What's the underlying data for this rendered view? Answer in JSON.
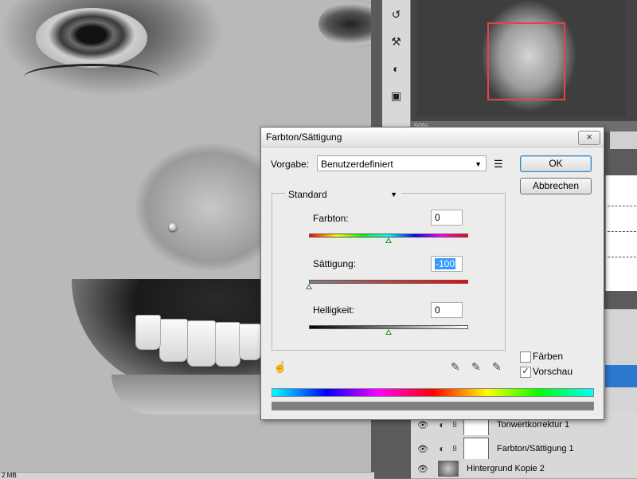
{
  "dialog": {
    "title": "Farbton/Sättigung",
    "close_label": "×",
    "preset_label": "Vorgabe:",
    "preset_value": "Benutzerdefiniert",
    "channel_value": "Standard",
    "ok_label": "OK",
    "cancel_label": "Abbrechen",
    "hue_label": "Farbton:",
    "hue_value": "0",
    "hue_level": 0.0,
    "saturation_label": "Sättigung:",
    "saturation_value": "-100",
    "saturation_level": -100,
    "lightness_label": "Helligkeit:",
    "lightness_value": "0",
    "lightness_level": 0,
    "colorize_label": "Färben",
    "colorize_checked": false,
    "preview_label": "Vorschau",
    "preview_checked": true,
    "check_mark": "✓"
  },
  "layers": [
    {
      "name": "Tonwertkorrektur 1"
    },
    {
      "name": "Farbton/Sättigung 1"
    },
    {
      "name": "Hintergrund Kopie 2"
    }
  ],
  "navigator": {
    "zoom": "50%"
  },
  "status": {
    "doc_size": "2 MB"
  },
  "icons": {
    "eye": "👁",
    "adjustment": "◐",
    "chain": "8",
    "chevron": "▼",
    "preset_menu": "☰",
    "hand": "☝",
    "eyedropper": "✎",
    "cursor": "➤"
  },
  "colors": {
    "accent": "#3399ff",
    "layer_selected": "#2b78d1",
    "navigator_box": "#e14545",
    "slider_thumb": "#2d8a2d"
  }
}
